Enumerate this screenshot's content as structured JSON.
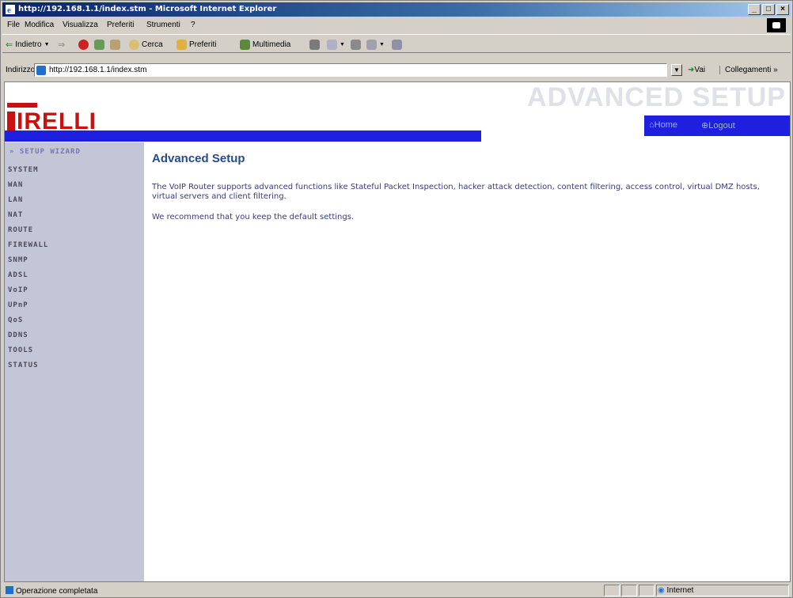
{
  "window": {
    "title": "http://192.168.1.1/index.stm - Microsoft Internet Explorer",
    "controls": [
      "_",
      "□",
      "×"
    ]
  },
  "menubar": {
    "items": [
      "File",
      "Modifica",
      "Visualizza",
      "Preferiti",
      "Strumenti",
      "?"
    ]
  },
  "toolbar": {
    "back_label": "Indietro",
    "search_label": "Cerca",
    "favorites_label": "Preferiti",
    "media_label": "Multimedia"
  },
  "addressbar": {
    "label": "Indirizzo",
    "url": "http://192.168.1.1/index.stm",
    "go_label": "Vai",
    "links_label": "Collegamenti »"
  },
  "banner": {
    "logo_text": "IRELLI",
    "title": "ADVANCED SETUP",
    "home_label": "Home",
    "logout_label": "Logout"
  },
  "sidebar": {
    "wizard_label": "» SETUP WIZARD",
    "items": [
      "SYSTEM",
      "WAN",
      "LAN",
      "NAT",
      "ROUTE",
      "FIREWALL",
      "SNMP",
      "ADSL",
      "VoIP",
      "UPnP",
      "QoS",
      "DDNS",
      "TOOLS",
      "STATUS"
    ]
  },
  "content": {
    "heading": "Advanced Setup",
    "paragraph1": "The VoIP Router supports advanced functions like Stateful Packet Inspection, hacker attack detection, content filtering, access control, virtual DMZ hosts, virtual servers and client filtering.",
    "paragraph2": "We recommend that you keep the default settings."
  },
  "statusbar": {
    "text": "Operazione completata",
    "zone": "Internet"
  }
}
